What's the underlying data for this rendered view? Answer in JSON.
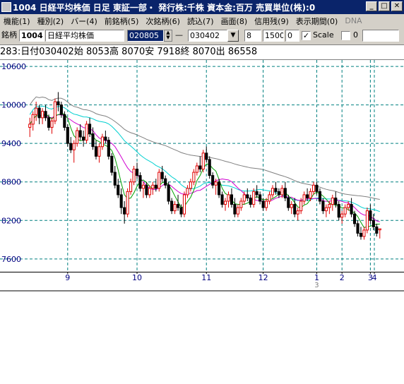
{
  "window": {
    "title": "1004 日経平均株価 日足 東証一部・ 発行株:千株 資本金:百万 売買単位(株):0"
  },
  "menu": [
    {
      "label": "機能(1)",
      "disabled": false
    },
    {
      "label": "種別(2)",
      "disabled": false
    },
    {
      "label": "バー(4)",
      "disabled": false
    },
    {
      "label": "前銘柄(5)",
      "disabled": false
    },
    {
      "label": "次銘柄(6)",
      "disabled": false
    },
    {
      "label": "読込(7)",
      "disabled": false
    },
    {
      "label": "画面(8)",
      "disabled": false
    },
    {
      "label": "信用残(9)",
      "disabled": false
    },
    {
      "label": "表示期間(0)",
      "disabled": false
    },
    {
      "label": "DNA",
      "disabled": true
    }
  ],
  "toolbar": {
    "stock_label": "銘柄",
    "code": "1004",
    "name": "日経平均株価",
    "date_from": "020805",
    "dash": "—",
    "date_to": "030402",
    "field_a": "8",
    "field_b": "1500",
    "field_c": "0",
    "scale_checked": true,
    "scale_label": "Scale",
    "field_d": "0",
    "field_d_checked": false
  },
  "info": {
    "text": "283:日付030402始 8053高 8070安 7918終 8070出 86558"
  },
  "chart_data": {
    "type": "candlestick",
    "ylim": [
      7400,
      10700
    ],
    "y_ticks": [
      10600,
      10000,
      9400,
      8800,
      8200,
      7600
    ],
    "x_month_labels": [
      "9",
      "10",
      "11",
      "12",
      "1",
      "2",
      "3",
      "4"
    ],
    "x_year_label": "3",
    "candles": [
      [
        9650,
        9800,
        9500,
        9700
      ],
      [
        9700,
        9900,
        9600,
        9850
      ],
      [
        9850,
        10050,
        9750,
        9950
      ],
      [
        9950,
        10000,
        9700,
        9800
      ],
      [
        9800,
        9950,
        9700,
        9900
      ],
      [
        9900,
        10000,
        9750,
        9800
      ],
      [
        9800,
        9850,
        9600,
        9650
      ],
      [
        9650,
        9800,
        9550,
        9750
      ],
      [
        9750,
        10100,
        9700,
        10050
      ],
      [
        10050,
        10200,
        9900,
        10000
      ],
      [
        10000,
        10050,
        9800,
        9850
      ],
      [
        9850,
        9900,
        9600,
        9650
      ],
      [
        9650,
        9700,
        9350,
        9400
      ],
      [
        9400,
        9500,
        9250,
        9300
      ],
      [
        9300,
        9450,
        9100,
        9400
      ],
      [
        9400,
        9650,
        9350,
        9600
      ],
      [
        9600,
        9700,
        9450,
        9500
      ],
      [
        9500,
        9600,
        9350,
        9450
      ],
      [
        9450,
        9750,
        9400,
        9700
      ],
      [
        9700,
        9800,
        9500,
        9550
      ],
      [
        9550,
        9650,
        9300,
        9350
      ],
      [
        9350,
        9450,
        9150,
        9200
      ],
      [
        9200,
        9400,
        9100,
        9350
      ],
      [
        9350,
        9550,
        9300,
        9500
      ],
      [
        9500,
        9600,
        9400,
        9450
      ],
      [
        9450,
        9500,
        9150,
        9200
      ],
      [
        9200,
        9250,
        8900,
        8950
      ],
      [
        8950,
        9050,
        8700,
        8750
      ],
      [
        8750,
        8850,
        8550,
        8600
      ],
      [
        8600,
        8700,
        8300,
        8400
      ],
      [
        8400,
        8500,
        8150,
        8300
      ],
      [
        8300,
        8700,
        8250,
        8650
      ],
      [
        8650,
        8850,
        8600,
        8800
      ],
      [
        8800,
        9050,
        8750,
        9000
      ],
      [
        9000,
        9100,
        8850,
        8900
      ],
      [
        8900,
        8950,
        8650,
        8700
      ],
      [
        8700,
        8800,
        8550,
        8750
      ],
      [
        8750,
        8800,
        8550,
        8600
      ],
      [
        8600,
        8750,
        8550,
        8700
      ],
      [
        8700,
        8800,
        8600,
        8750
      ],
      [
        8750,
        8850,
        8650,
        8700
      ],
      [
        8700,
        9000,
        8650,
        8950
      ],
      [
        8950,
        9050,
        8800,
        8850
      ],
      [
        8850,
        8900,
        8700,
        8750
      ],
      [
        8750,
        8800,
        8450,
        8500
      ],
      [
        8500,
        8550,
        8300,
        8350
      ],
      [
        8350,
        8500,
        8300,
        8450
      ],
      [
        8450,
        8600,
        8350,
        8400
      ],
      [
        8400,
        8450,
        8250,
        8300
      ],
      [
        8300,
        8650,
        8250,
        8600
      ],
      [
        8600,
        8750,
        8550,
        8700
      ],
      [
        8700,
        8850,
        8650,
        8800
      ],
      [
        8800,
        9000,
        8750,
        8950
      ],
      [
        8950,
        9100,
        8900,
        9050
      ],
      [
        9050,
        9200,
        8950,
        9000
      ],
      [
        9000,
        9300,
        8950,
        9250
      ],
      [
        9250,
        9350,
        9100,
        9150
      ],
      [
        9150,
        9200,
        8850,
        8900
      ],
      [
        8900,
        8950,
        8700,
        8750
      ],
      [
        8750,
        8850,
        8600,
        8800
      ],
      [
        8800,
        8850,
        8550,
        8600
      ],
      [
        8600,
        8650,
        8400,
        8450
      ],
      [
        8450,
        8550,
        8350,
        8500
      ],
      [
        8500,
        8650,
        8400,
        8600
      ],
      [
        8600,
        8700,
        8400,
        8450
      ],
      [
        8450,
        8550,
        8250,
        8300
      ],
      [
        8300,
        8450,
        8250,
        8400
      ],
      [
        8400,
        8550,
        8350,
        8500
      ],
      [
        8500,
        8650,
        8450,
        8600
      ],
      [
        8600,
        8700,
        8500,
        8550
      ],
      [
        8550,
        8600,
        8400,
        8450
      ],
      [
        8450,
        8700,
        8400,
        8650
      ],
      [
        8650,
        8750,
        8550,
        8600
      ],
      [
        8600,
        8650,
        8450,
        8500
      ],
      [
        8500,
        8550,
        8350,
        8400
      ],
      [
        8400,
        8550,
        8350,
        8500
      ],
      [
        8500,
        8650,
        8450,
        8600
      ],
      [
        8600,
        8750,
        8550,
        8700
      ],
      [
        8700,
        8800,
        8600,
        8650
      ],
      [
        8650,
        8700,
        8550,
        8600
      ],
      [
        8600,
        8750,
        8550,
        8700
      ],
      [
        8700,
        8800,
        8500,
        8550
      ],
      [
        8550,
        8600,
        8350,
        8400
      ],
      [
        8400,
        8500,
        8300,
        8450
      ],
      [
        8450,
        8550,
        8250,
        8300
      ],
      [
        8300,
        8400,
        8200,
        8350
      ],
      [
        8350,
        8550,
        8300,
        8500
      ],
      [
        8500,
        8650,
        8450,
        8600
      ],
      [
        8600,
        8700,
        8500,
        8550
      ],
      [
        8550,
        8700,
        8500,
        8650
      ],
      [
        8650,
        8800,
        8600,
        8750
      ],
      [
        8750,
        8800,
        8600,
        8650
      ],
      [
        8650,
        8700,
        8450,
        8500
      ],
      [
        8500,
        8550,
        8300,
        8350
      ],
      [
        8350,
        8450,
        8250,
        8400
      ],
      [
        8400,
        8500,
        8300,
        8450
      ],
      [
        8450,
        8600,
        8350,
        8550
      ],
      [
        8550,
        8650,
        8400,
        8450
      ],
      [
        8450,
        8500,
        8200,
        8250
      ],
      [
        8250,
        8350,
        8150,
        8300
      ],
      [
        8300,
        8450,
        8250,
        8400
      ],
      [
        8400,
        8500,
        8350,
        8450
      ],
      [
        8450,
        8550,
        8250,
        8300
      ],
      [
        8300,
        8350,
        8100,
        8150
      ],
      [
        8150,
        8200,
        7950,
        8000
      ],
      [
        8000,
        8100,
        7900,
        7950
      ],
      [
        7950,
        8100,
        7900,
        8050
      ],
      [
        8050,
        8400,
        8000,
        8350
      ],
      [
        8350,
        8450,
        8150,
        8200
      ],
      [
        8200,
        8300,
        8050,
        8100
      ],
      [
        8100,
        8150,
        7950,
        8000
      ],
      [
        8053,
        8070,
        7918,
        8070
      ]
    ]
  },
  "colors": {
    "title_bg": "#0a246a",
    "up": "#e00000",
    "down": "#000000",
    "grid": "#008080",
    "ma_short": "#00a000",
    "ma_mid": "#d000d0",
    "ma_long": "#00d0d0",
    "ma_xlong": "#808080",
    "axis_text": "#000080"
  }
}
